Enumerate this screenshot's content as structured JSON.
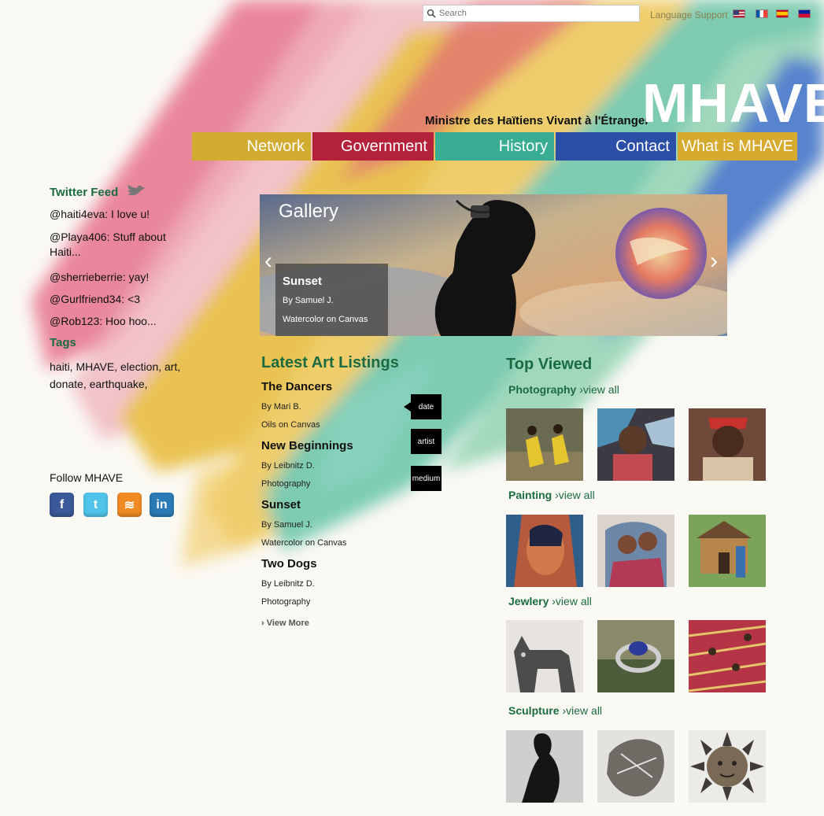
{
  "header": {
    "search_placeholder": "Search",
    "language_label": "Language Support",
    "flags": [
      "us-flag",
      "france-flag",
      "spain-flag",
      "haiti-flag"
    ],
    "tagline": "Ministre des Haïtiens Vivant à l'Étranger",
    "logo": "MHAVE"
  },
  "nav": {
    "items": [
      {
        "label": "Network",
        "color": "#d2ac31"
      },
      {
        "label": "Government",
        "color": "#b3213a"
      },
      {
        "label": "History",
        "color": "#39ad93"
      },
      {
        "label": "Contact",
        "color": "#2b4fa6"
      },
      {
        "label": "What is MHAVE",
        "color": "#d5aa2e"
      }
    ]
  },
  "sidebar": {
    "twitter_title": "Twitter Feed",
    "tweets": [
      "@haiti4eva: I love u!",
      "@Playa406: Stuff about Haiti...",
      "@sherrieberrie: yay!",
      "@Gurlfriend34: <3",
      "@Rob123: Hoo hoo..."
    ],
    "tags_title": "Tags",
    "tags": "haiti, MHAVE, election, art, donate, earthquake,",
    "follow_label": "Follow MHAVE",
    "social": [
      {
        "name": "facebook-icon",
        "glyph": "f",
        "color": "#3b5998"
      },
      {
        "name": "twitter-icon",
        "glyph": "t",
        "color": "#4fc3ea"
      },
      {
        "name": "rss-icon",
        "glyph": "≋",
        "color": "#f08a24"
      },
      {
        "name": "linkedin-icon",
        "glyph": "in",
        "color": "#2a7ab5"
      }
    ]
  },
  "gallery": {
    "title": "Gallery",
    "caption_title": "Sunset",
    "caption_by": "By Samuel J.",
    "caption_medium": "Watercolor on Canvas",
    "prev": "‹",
    "next": "›"
  },
  "latest": {
    "title": "Latest Art Listings",
    "items": [
      {
        "title": "The Dancers",
        "by": "By Mari B.",
        "medium": "Oils on Canvas"
      },
      {
        "title": "New Beginnings",
        "by": "By Leibnitz D.",
        "medium": "Photography"
      },
      {
        "title": "Sunset",
        "by": "By Samuel J.",
        "medium": "Watercolor on Canvas"
      },
      {
        "title": "Two Dogs",
        "by": "By Leibnitz D.",
        "medium": "Photography"
      }
    ],
    "view_more": "› View More",
    "sort_buttons": [
      "date",
      "artist",
      "medium"
    ]
  },
  "top_viewed": {
    "title": "Top Viewed",
    "view_all": "›view all",
    "categories": [
      {
        "label": "Photography"
      },
      {
        "label": "Painting"
      },
      {
        "label": "Jewlery"
      },
      {
        "label": "Sculpture"
      }
    ]
  }
}
